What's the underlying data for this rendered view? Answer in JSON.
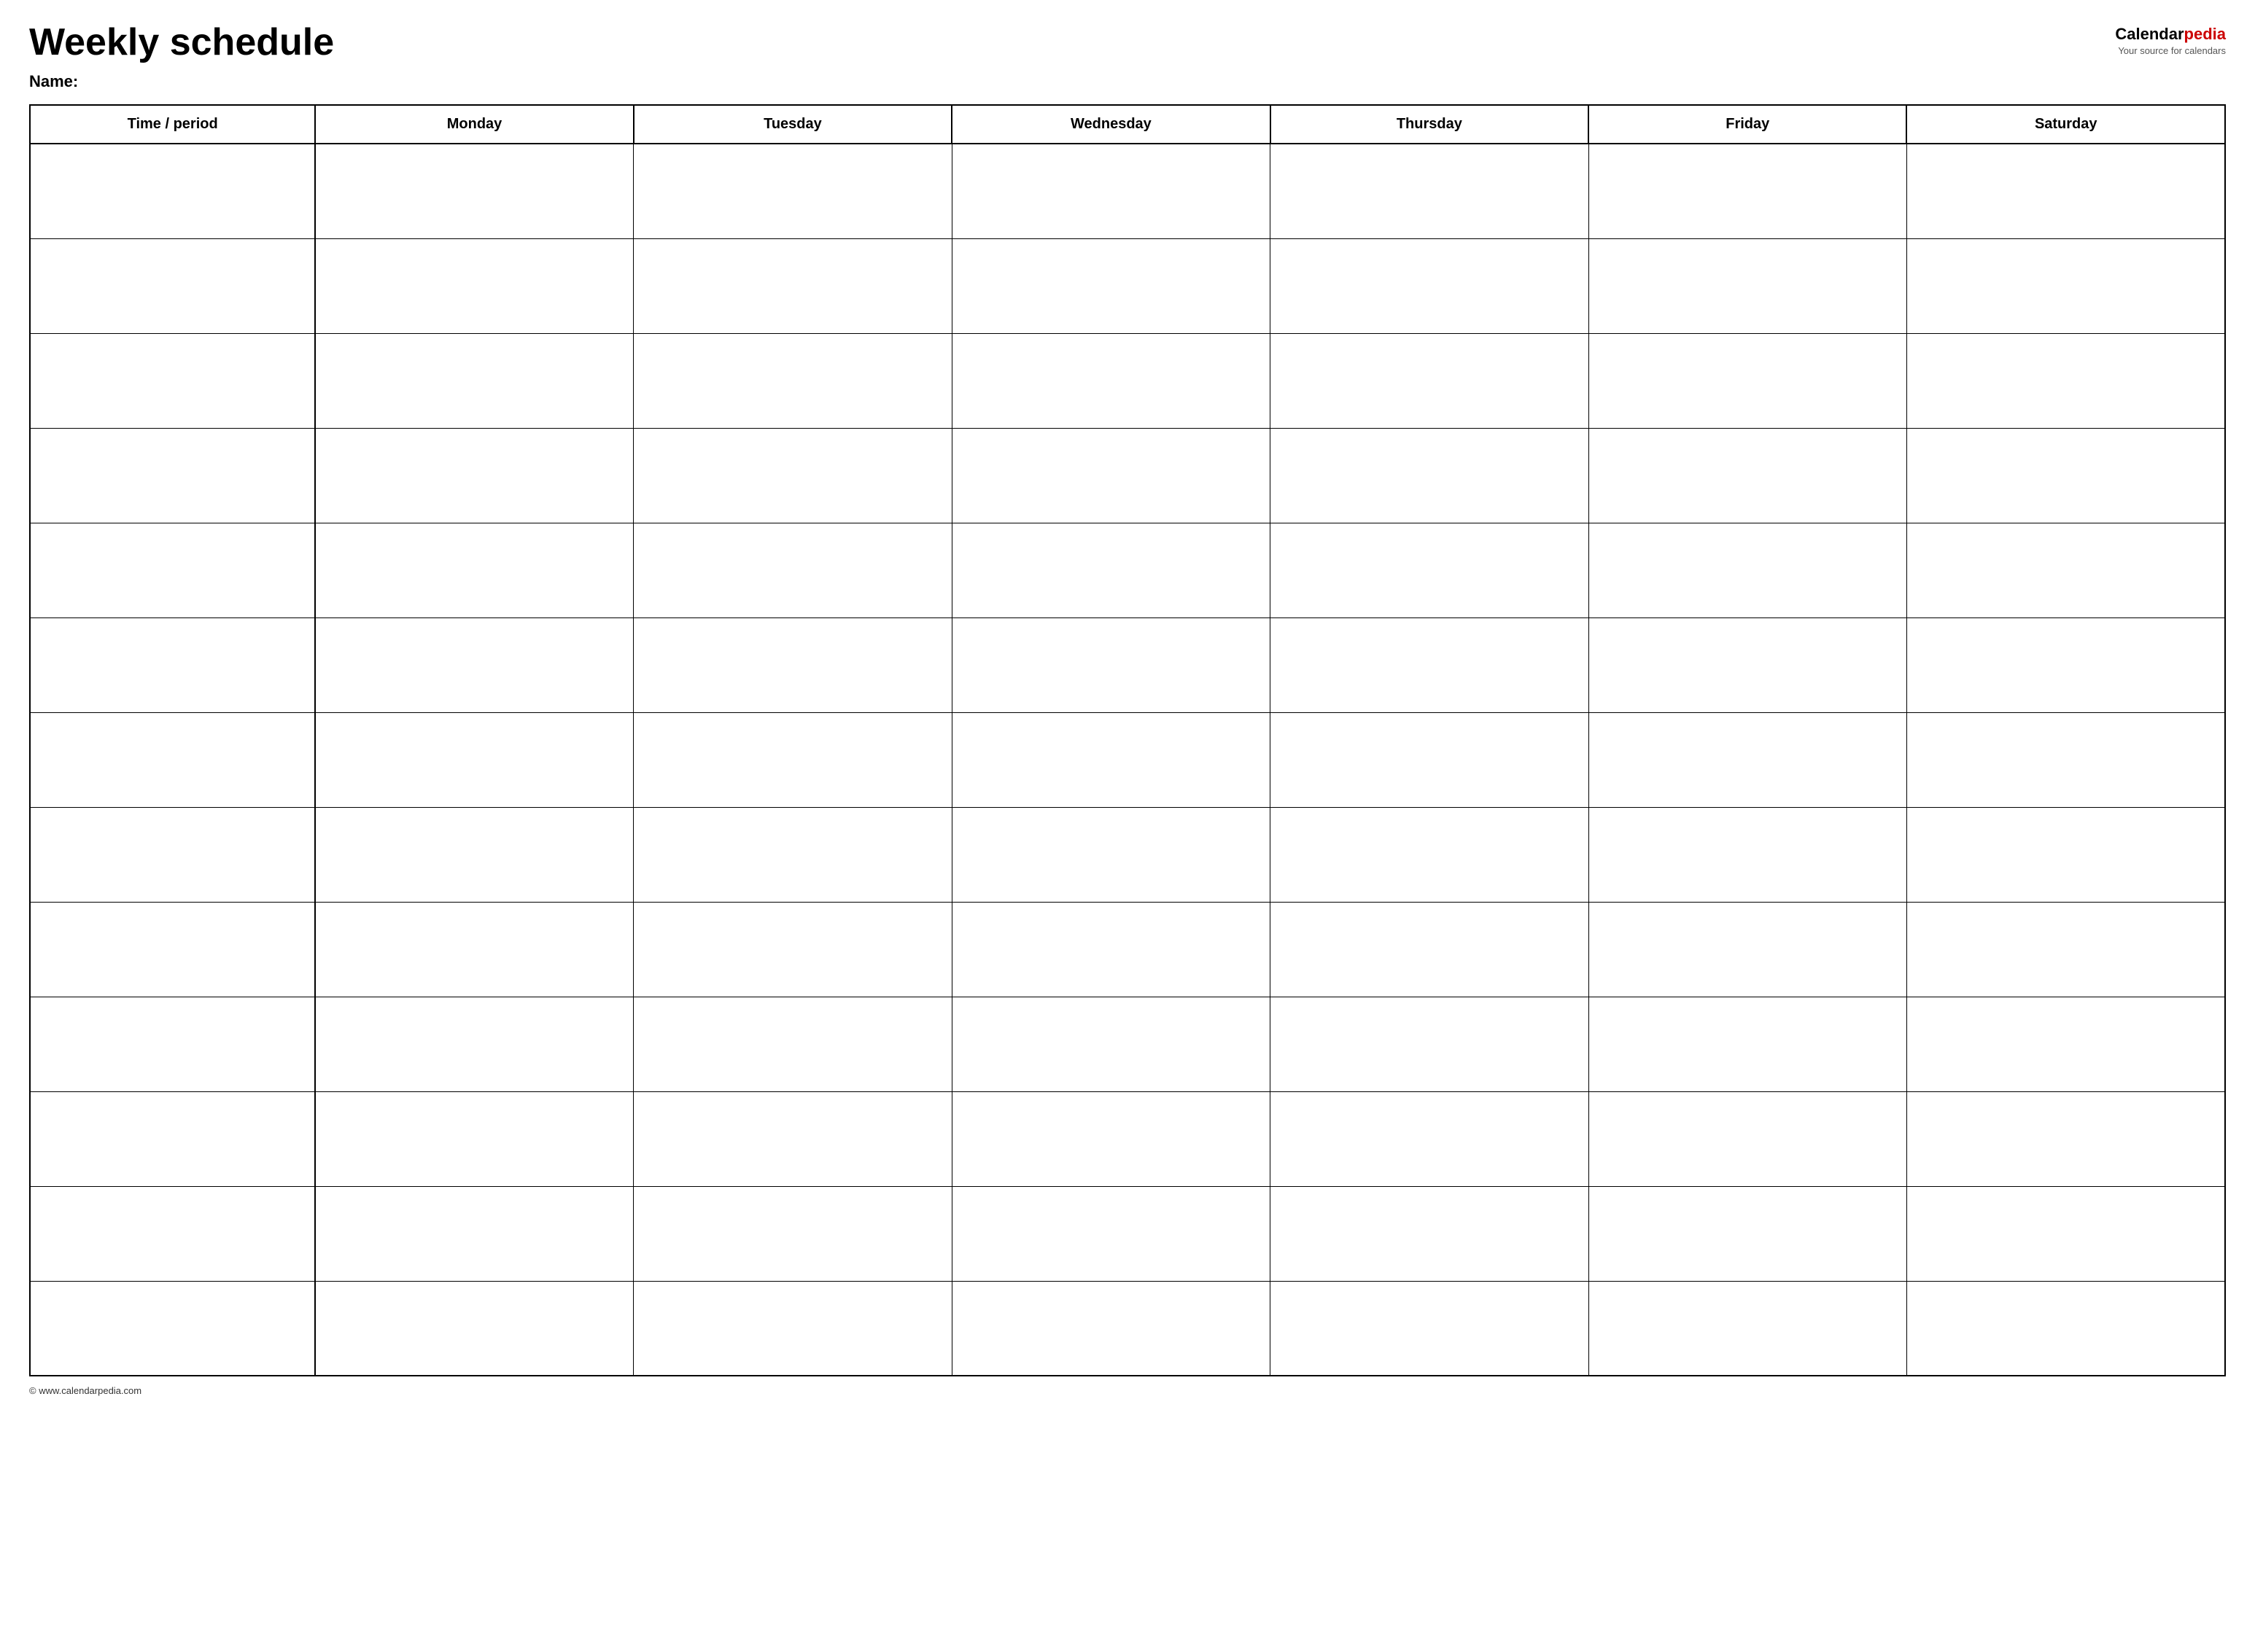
{
  "header": {
    "title": "Weekly schedule",
    "logo": {
      "calendar": "Calendar",
      "pedia": "pedia",
      "tagline": "Your source for calendars"
    },
    "name_label": "Name:"
  },
  "table": {
    "columns": [
      {
        "label": "Time / period",
        "key": "time"
      },
      {
        "label": "Monday",
        "key": "monday"
      },
      {
        "label": "Tuesday",
        "key": "tuesday"
      },
      {
        "label": "Wednesday",
        "key": "wednesday"
      },
      {
        "label": "Thursday",
        "key": "thursday"
      },
      {
        "label": "Friday",
        "key": "friday"
      },
      {
        "label": "Saturday",
        "key": "saturday"
      }
    ],
    "row_count": 13
  },
  "footer": {
    "text": "© www.calendarpedia.com"
  }
}
